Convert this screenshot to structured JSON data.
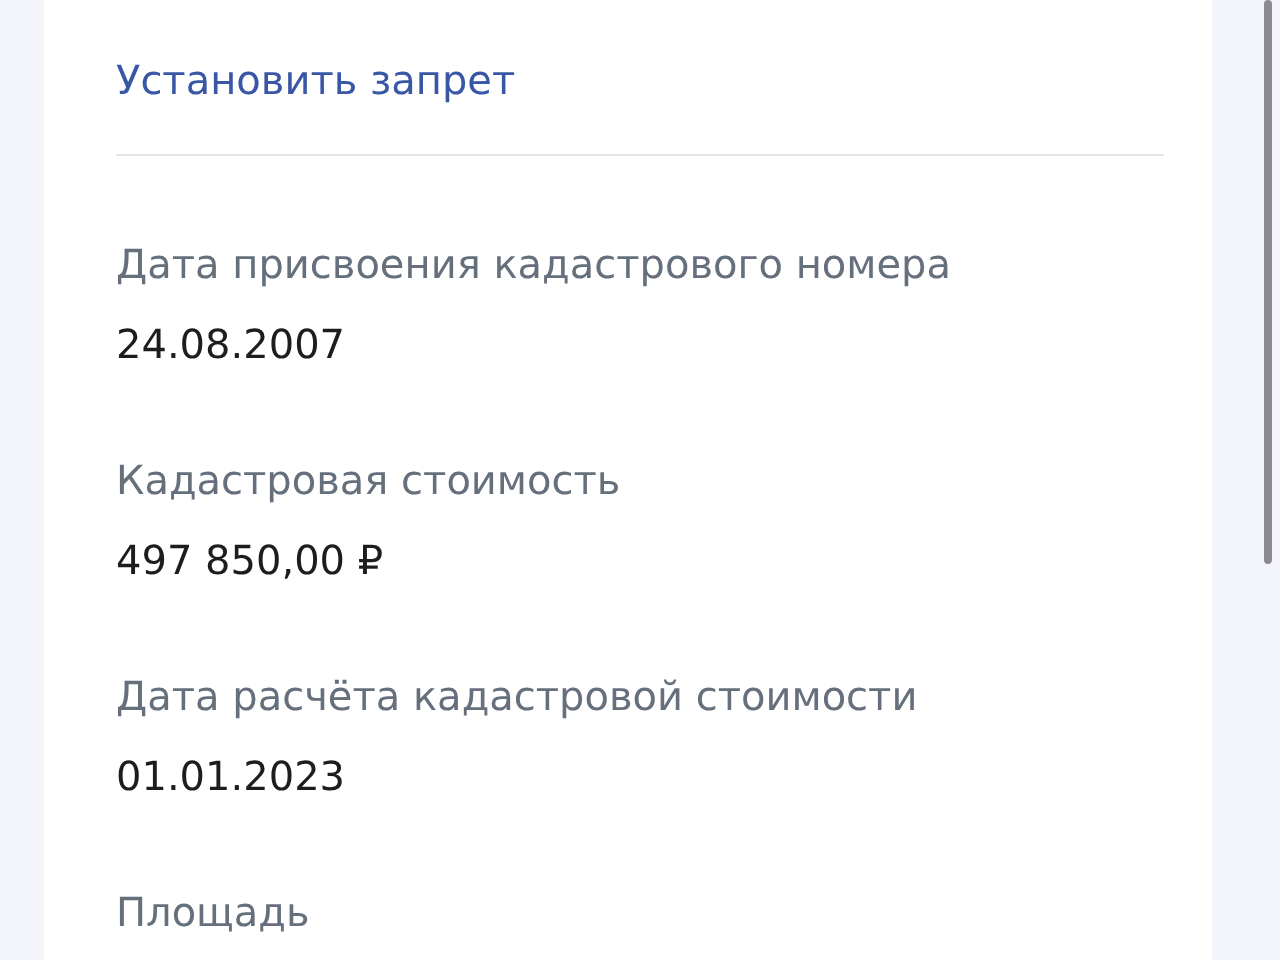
{
  "action_link": "Установить запрет",
  "fields": [
    {
      "label": "Дата присвоения кадастрового номера",
      "value": "24.08.2007"
    },
    {
      "label": "Кадастровая стоимость",
      "value": "497 850,00 ₽"
    },
    {
      "label": "Дата расчёта кадастровой стоимости",
      "value": "01.01.2023"
    },
    {
      "label": "Площадь"
    }
  ]
}
